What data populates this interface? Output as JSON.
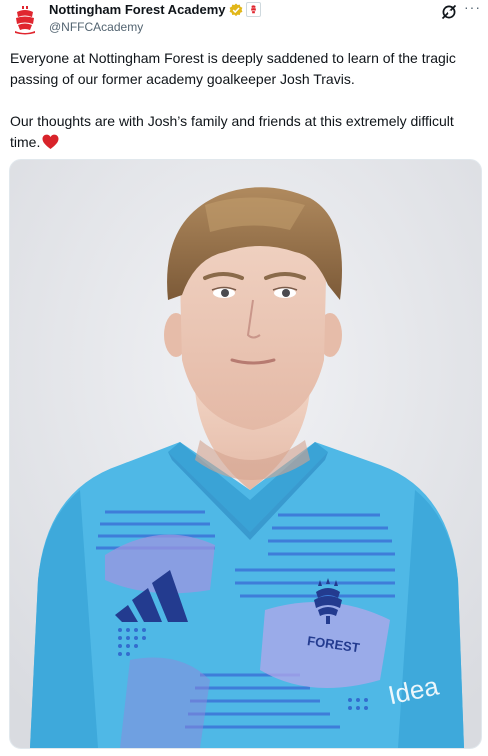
{
  "account": {
    "display_name": "Nottingham Forest Academy",
    "handle": "@NFFCAcademy",
    "avatar_icon": "nottingham-forest-crest",
    "verified_icon": "gold-verified-badge",
    "affiliate_icon": "club-affiliate-badge"
  },
  "actions": {
    "grok_icon": "grok-icon",
    "more_icon": "more-icon",
    "more_label": "···"
  },
  "tweet": {
    "paragraph_1": "Everyone at Nottingham Forest is deeply saddened to learn of the tragic passing of our former academy goalkeeper Josh Travis.",
    "paragraph_2": "Our thoughts are with Josh’s family and friends at this extremely difficult time.",
    "emoji_icon": "red-heart-icon"
  },
  "media": {
    "kind": "photo",
    "shirt_badge_text": "FOREST",
    "sponsor_text": "Idea"
  },
  "colors": {
    "text": "#0f1419",
    "secondary": "#536471",
    "club_red": "#e0262f",
    "shirt": "#4fb8e6",
    "heart": "#d8232a"
  }
}
